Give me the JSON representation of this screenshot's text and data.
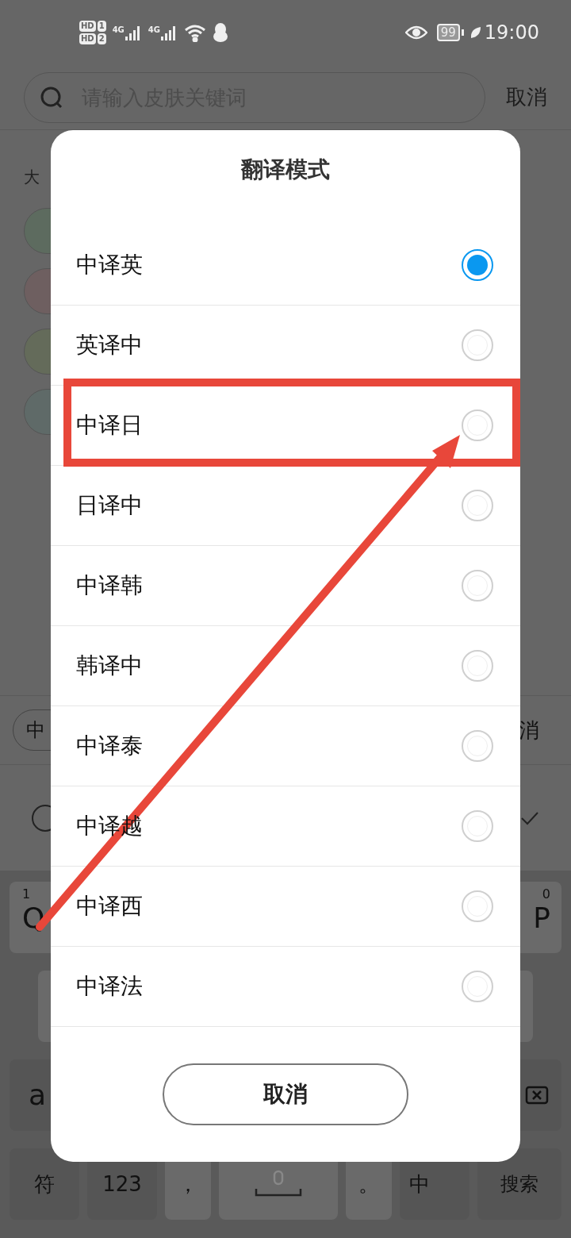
{
  "status_bar": {
    "sim_labels": [
      {
        "tag": "HD",
        "slot": "1"
      },
      {
        "tag": "HD",
        "slot": "2"
      }
    ],
    "network": [
      "4G",
      "4G"
    ],
    "battery": "99",
    "time": "19:00"
  },
  "search": {
    "placeholder": "请输入皮肤关键词",
    "cancel": "取消"
  },
  "background": {
    "section_label": "大",
    "input_prefix": "中",
    "cancel_fragment": "消"
  },
  "keyboard": {
    "q_hint": "1",
    "q": "Q",
    "p_hint": "0",
    "p": "P",
    "abc": "a",
    "symbols": "符",
    "numbers": "123",
    "comma": "，",
    "period": "。",
    "lang": "中",
    "search": "搜索"
  },
  "dialog": {
    "title": "翻译模式",
    "options": [
      {
        "label": "中译英",
        "selected": true
      },
      {
        "label": "英译中",
        "selected": false
      },
      {
        "label": "中译日",
        "selected": false
      },
      {
        "label": "日译中",
        "selected": false
      },
      {
        "label": "中译韩",
        "selected": false
      },
      {
        "label": "韩译中",
        "selected": false
      },
      {
        "label": "中译泰",
        "selected": false
      },
      {
        "label": "中译越",
        "selected": false
      },
      {
        "label": "中译西",
        "selected": false
      },
      {
        "label": "中译法",
        "selected": false
      }
    ],
    "cancel_button": "取消"
  }
}
